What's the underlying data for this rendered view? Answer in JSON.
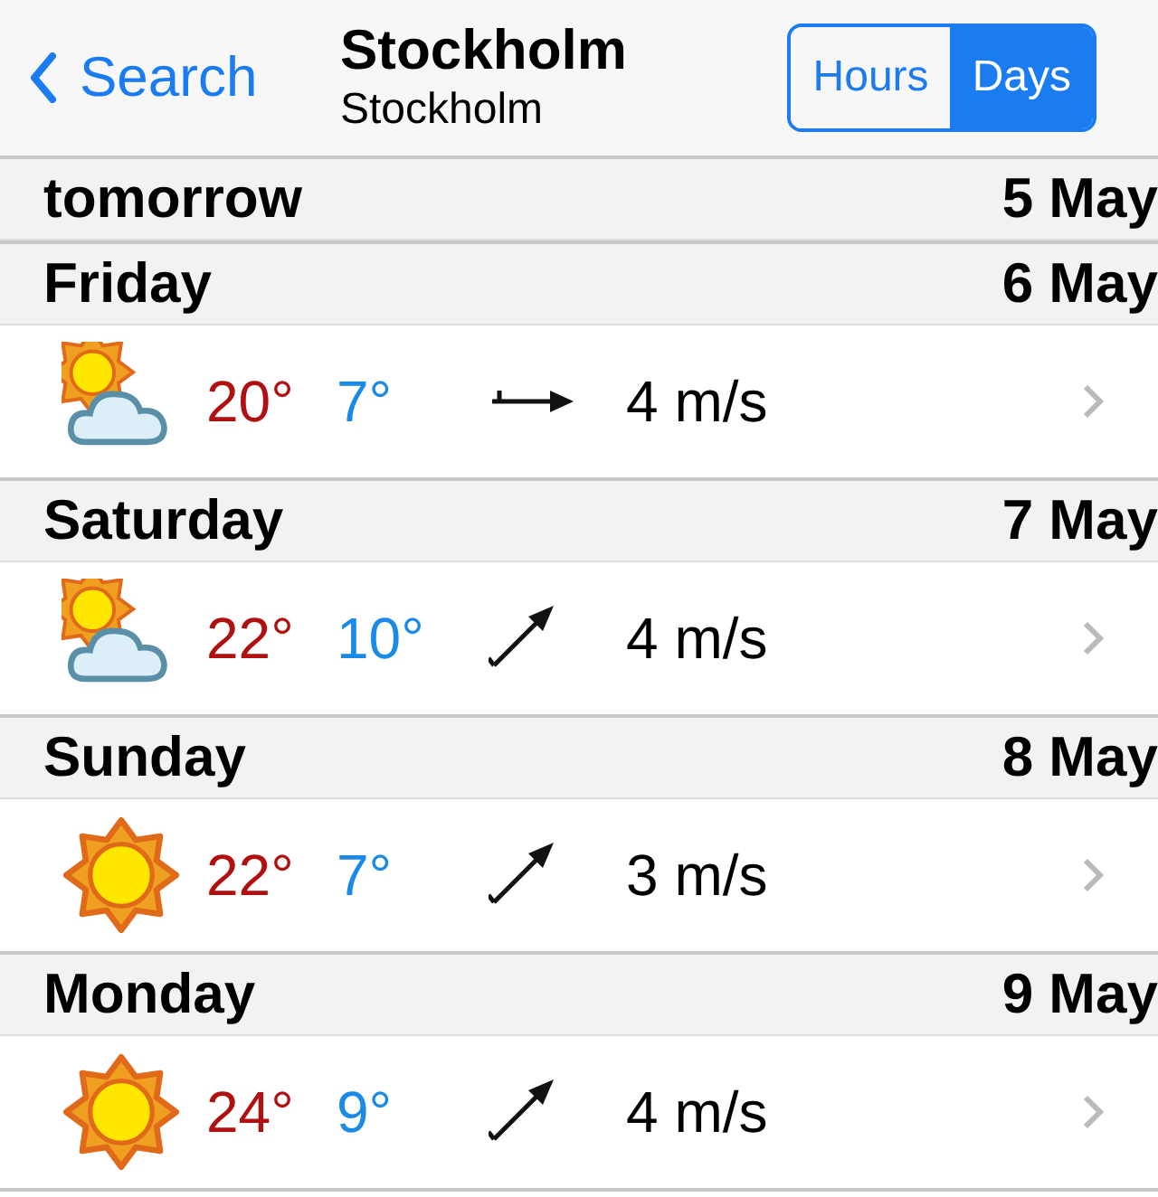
{
  "nav": {
    "back": "Search",
    "title": "Stockholm",
    "subtitle": "Stockholm",
    "segments": [
      {
        "label": "Hours",
        "selected": false
      },
      {
        "label": "Days",
        "selected": true
      }
    ]
  },
  "days": [
    {
      "day": "tomorrow",
      "date": "5 May"
    },
    {
      "day": "Friday",
      "date": "6 May",
      "forecast": {
        "kind": "partly-cloudy",
        "high": "20°",
        "low": "7°",
        "wind": {
          "kind": "east",
          "speed": "4 m/s"
        }
      }
    },
    {
      "day": "Saturday",
      "date": "7 May",
      "forecast": {
        "kind": "partly-cloudy",
        "high": "22°",
        "low": "10°",
        "wind": {
          "kind": "northeast",
          "speed": "4 m/s"
        }
      }
    },
    {
      "day": "Sunday",
      "date": "8 May",
      "forecast": {
        "kind": "sunny",
        "high": "22°",
        "low": "7°",
        "wind": {
          "kind": "northeast",
          "speed": "3 m/s"
        }
      }
    },
    {
      "day": "Monday",
      "date": "9 May",
      "forecast": {
        "kind": "sunny",
        "high": "24°",
        "low": "9°",
        "wind": {
          "kind": "northeast",
          "speed": "4 m/s"
        }
      }
    }
  ]
}
